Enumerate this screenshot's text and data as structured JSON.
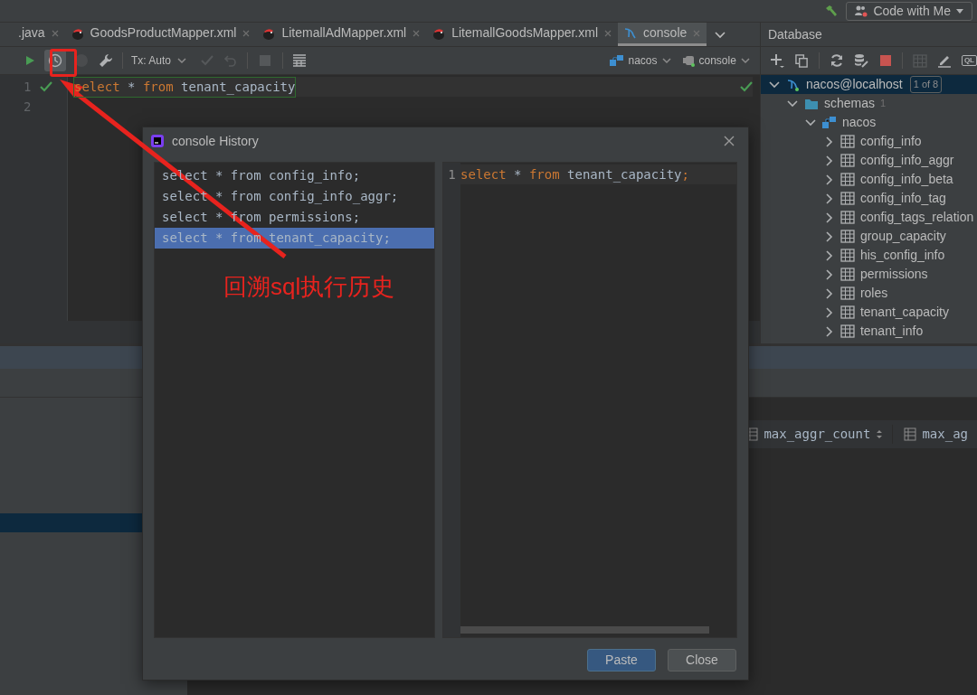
{
  "top_bar": {
    "code_with_me": "Code with Me"
  },
  "editor_tabs": [
    {
      "label": ".java",
      "kind": "plain",
      "selected": false
    },
    {
      "label": "GoodsProductMapper.xml",
      "kind": "mapper",
      "selected": false
    },
    {
      "label": "LitemallAdMapper.xml",
      "kind": "mapper",
      "selected": false
    },
    {
      "label": "LitemallGoodsMapper.xml",
      "kind": "mapper",
      "selected": false
    },
    {
      "label": "console",
      "kind": "console",
      "selected": true
    }
  ],
  "toolbar": {
    "tx_mode": "Tx: Auto",
    "datasource": "nacos",
    "session": "console"
  },
  "editor": {
    "lines": [
      {
        "number": "1",
        "ok": true,
        "tokens": [
          {
            "text": "select",
            "kind": "keyword"
          },
          {
            "text": " * ",
            "kind": "plain"
          },
          {
            "text": "from",
            "kind": "keyword"
          },
          {
            "text": " tenant_capacity",
            "kind": "plain"
          }
        ]
      },
      {
        "number": "2",
        "ok": false
      }
    ]
  },
  "database": {
    "title": "Database",
    "icon_label": "QL",
    "tree": [
      {
        "label": "nacos@localhost",
        "badge": "1 of 8",
        "kind": "datasource",
        "expanded": true,
        "selected": true,
        "children": [
          {
            "label": "schemas",
            "count": "1",
            "kind": "folder",
            "expanded": true,
            "selected": false,
            "children": [
              {
                "label": "nacos",
                "kind": "schema",
                "expanded": true,
                "selected": false,
                "children": [
                  {
                    "label": "config_info",
                    "kind": "table",
                    "expanded": false,
                    "selected": false
                  },
                  {
                    "label": "config_info_aggr",
                    "kind": "table",
                    "expanded": false,
                    "selected": false
                  },
                  {
                    "label": "config_info_beta",
                    "kind": "table",
                    "expanded": false,
                    "selected": false
                  },
                  {
                    "label": "config_info_tag",
                    "kind": "table",
                    "expanded": false,
                    "selected": false
                  },
                  {
                    "label": "config_tags_relation",
                    "kind": "table",
                    "expanded": false,
                    "selected": false
                  },
                  {
                    "label": "group_capacity",
                    "kind": "table",
                    "expanded": false,
                    "selected": false
                  },
                  {
                    "label": "his_config_info",
                    "kind": "table",
                    "expanded": false,
                    "selected": false
                  },
                  {
                    "label": "permissions",
                    "kind": "table",
                    "expanded": false,
                    "selected": false
                  },
                  {
                    "label": "roles",
                    "kind": "table",
                    "expanded": false,
                    "selected": false
                  },
                  {
                    "label": "tenant_capacity",
                    "kind": "table",
                    "expanded": false,
                    "selected": false
                  },
                  {
                    "label": "tenant_info",
                    "kind": "table",
                    "expanded": false,
                    "selected": false
                  }
                ]
              }
            ]
          }
        ]
      }
    ]
  },
  "results": {
    "columns": [
      {
        "label": "max_aggr_count",
        "sortable": true
      },
      {
        "label": "max_ag",
        "sortable": false
      }
    ]
  },
  "dialog": {
    "title": "console History",
    "history": [
      {
        "text": "select * from config_info;",
        "selected": false
      },
      {
        "text": "select * from config_info_aggr;",
        "selected": false
      },
      {
        "text": "select * from permissions;",
        "selected": false
      },
      {
        "text": "select * from tenant_capacity;",
        "selected": true
      }
    ],
    "preview": {
      "number": "1",
      "tokens": [
        {
          "text": "select",
          "kind": "keyword"
        },
        {
          "text": " * ",
          "kind": "plain"
        },
        {
          "text": "from",
          "kind": "keyword"
        },
        {
          "text": " tenant_capacity",
          "kind": "plain"
        },
        {
          "text": ";",
          "kind": "keyword"
        }
      ]
    },
    "buttons": [
      {
        "label": "Paste",
        "primary": true
      },
      {
        "label": "Close",
        "primary": false
      }
    ]
  },
  "annotation": {
    "text": "回溯sql执行历史"
  }
}
